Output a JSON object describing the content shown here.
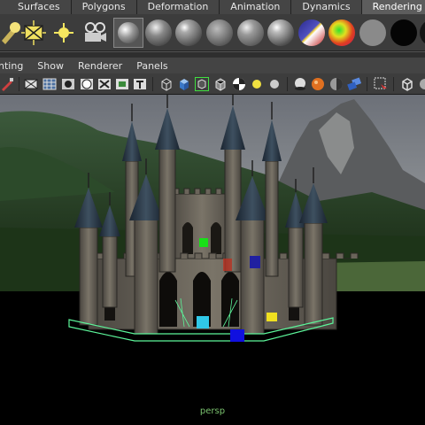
{
  "shelf_tabs": [
    "Surfaces",
    "Polygons",
    "Deformation",
    "Animation",
    "Dynamics",
    "Rendering"
  ],
  "panel_menu": [
    "nting",
    "Show",
    "Renderer",
    "Panels"
  ],
  "shelf_icons": [
    "light-brush-icon",
    "directional-light-icon",
    "point-light-icon",
    "camera-icon",
    "render-sphere-icon",
    "blinn-shader-icon",
    "phong-shader-icon",
    "lambert-shader-icon",
    "phong-e-shader-icon",
    "anisotropic-shader-icon",
    "surface-shader-icon",
    "ramp-shader-icon",
    "layered-shader-icon",
    "shading-black-icon"
  ],
  "viewport": {
    "camera_label": "persp"
  },
  "colors": {
    "selection_wire": "#5cf59a",
    "locator_green": "#18e018",
    "locator_red": "#c03020",
    "locator_navy": "#2020a0",
    "locator_cyan": "#30c8e8",
    "locator_yellow": "#f0e020",
    "locator_blue": "#1010e0"
  }
}
